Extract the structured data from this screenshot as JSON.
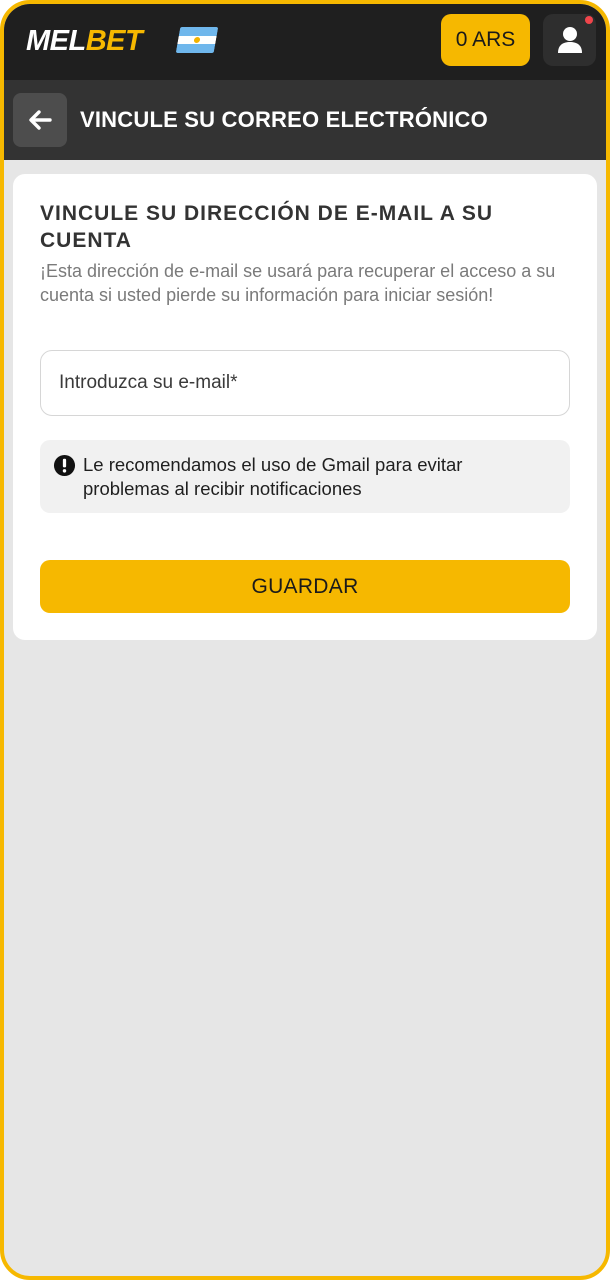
{
  "header": {
    "logo_part1": "MEL",
    "logo_part2": "BET",
    "flag_icon": "argentina-flag-icon",
    "balance_label": "0 ARS",
    "profile_icon": "user-icon",
    "notification_color": "#f0454b"
  },
  "subheader": {
    "back_icon": "arrow-left-icon",
    "title": "VINCULE SU CORREO ELECTRÓNICO"
  },
  "form": {
    "heading": "VINCULE SU DIRECCIÓN DE E-MAIL A SU CUENTA",
    "description": "¡Esta dirección de e-mail se usará para recuperar el acceso a su cuenta si usted pierde su información para iniciar sesión!",
    "email_placeholder": "Introduzca su e-mail*",
    "email_value": "",
    "notice_icon": "exclamation-circle-icon",
    "notice_text": "Le recomendamos el uso de Gmail para evitar problemas al recibir notificaciones",
    "save_label": "GUARDAR"
  },
  "colors": {
    "accent": "#f6b800",
    "topbar": "#1f1f1f",
    "subheader": "#333333",
    "background": "#e6e6e6"
  }
}
